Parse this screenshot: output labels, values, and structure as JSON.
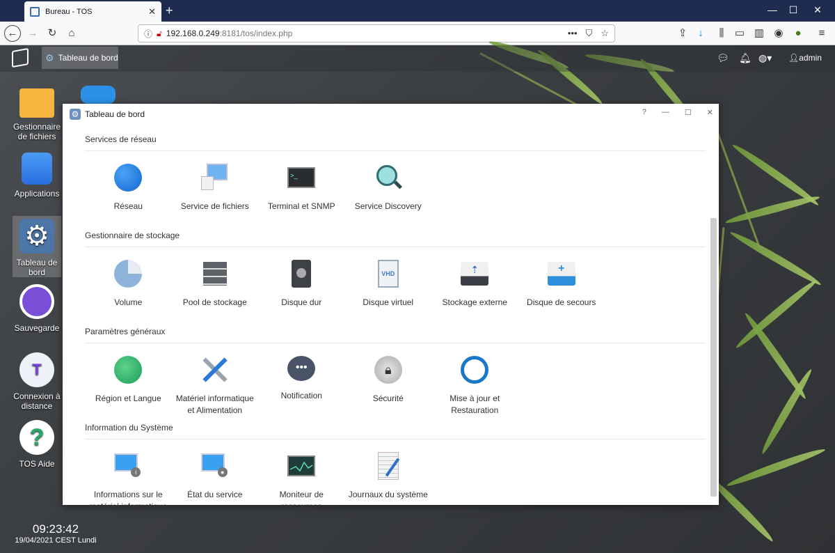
{
  "browser": {
    "tab_title": "Bureau - TOS",
    "url_host": "192.168.0.249",
    "url_rest": ":8181/tos/index.php",
    "win_min": "—",
    "win_max": "☐",
    "win_close": "✕"
  },
  "taskbar": {
    "active_app": "Tableau de bord",
    "user": "admin"
  },
  "desktop_icons": [
    {
      "label": "Gestionnaire de fichiers"
    },
    {
      "label": "Applications"
    },
    {
      "label": "Tableau de bord"
    },
    {
      "label": "Sauvegarde"
    },
    {
      "label": "Connexion à distance"
    },
    {
      "label": "TOS Aide"
    }
  ],
  "clock": {
    "time": "09:23:42",
    "date": "19/04/2021 CEST Lundi"
  },
  "window": {
    "title": "Tableau de bord",
    "help": "?",
    "sections": [
      {
        "title": "Services de réseau",
        "items": [
          "Réseau",
          "Service de fichiers",
          "Terminal et SNMP",
          "Service Discovery"
        ]
      },
      {
        "title": "Gestionnaire de stockage",
        "items": [
          "Volume",
          "Pool de stockage",
          "Disque dur",
          "Disque virtuel",
          "Stockage externe",
          "Disque de secours"
        ]
      },
      {
        "title": "Paramètres généraux",
        "items": [
          "Région et Langue",
          "Matériel informatique et Alimentation",
          "Notification",
          "Sécurité",
          "Mise à jour et Restauration"
        ]
      },
      {
        "title": "Information du Système",
        "items": [
          "Informations sur le matériel informatique",
          "État du service",
          "Moniteur de ressources",
          "Journaux du système"
        ]
      }
    ],
    "vhd_label": "VHD"
  }
}
